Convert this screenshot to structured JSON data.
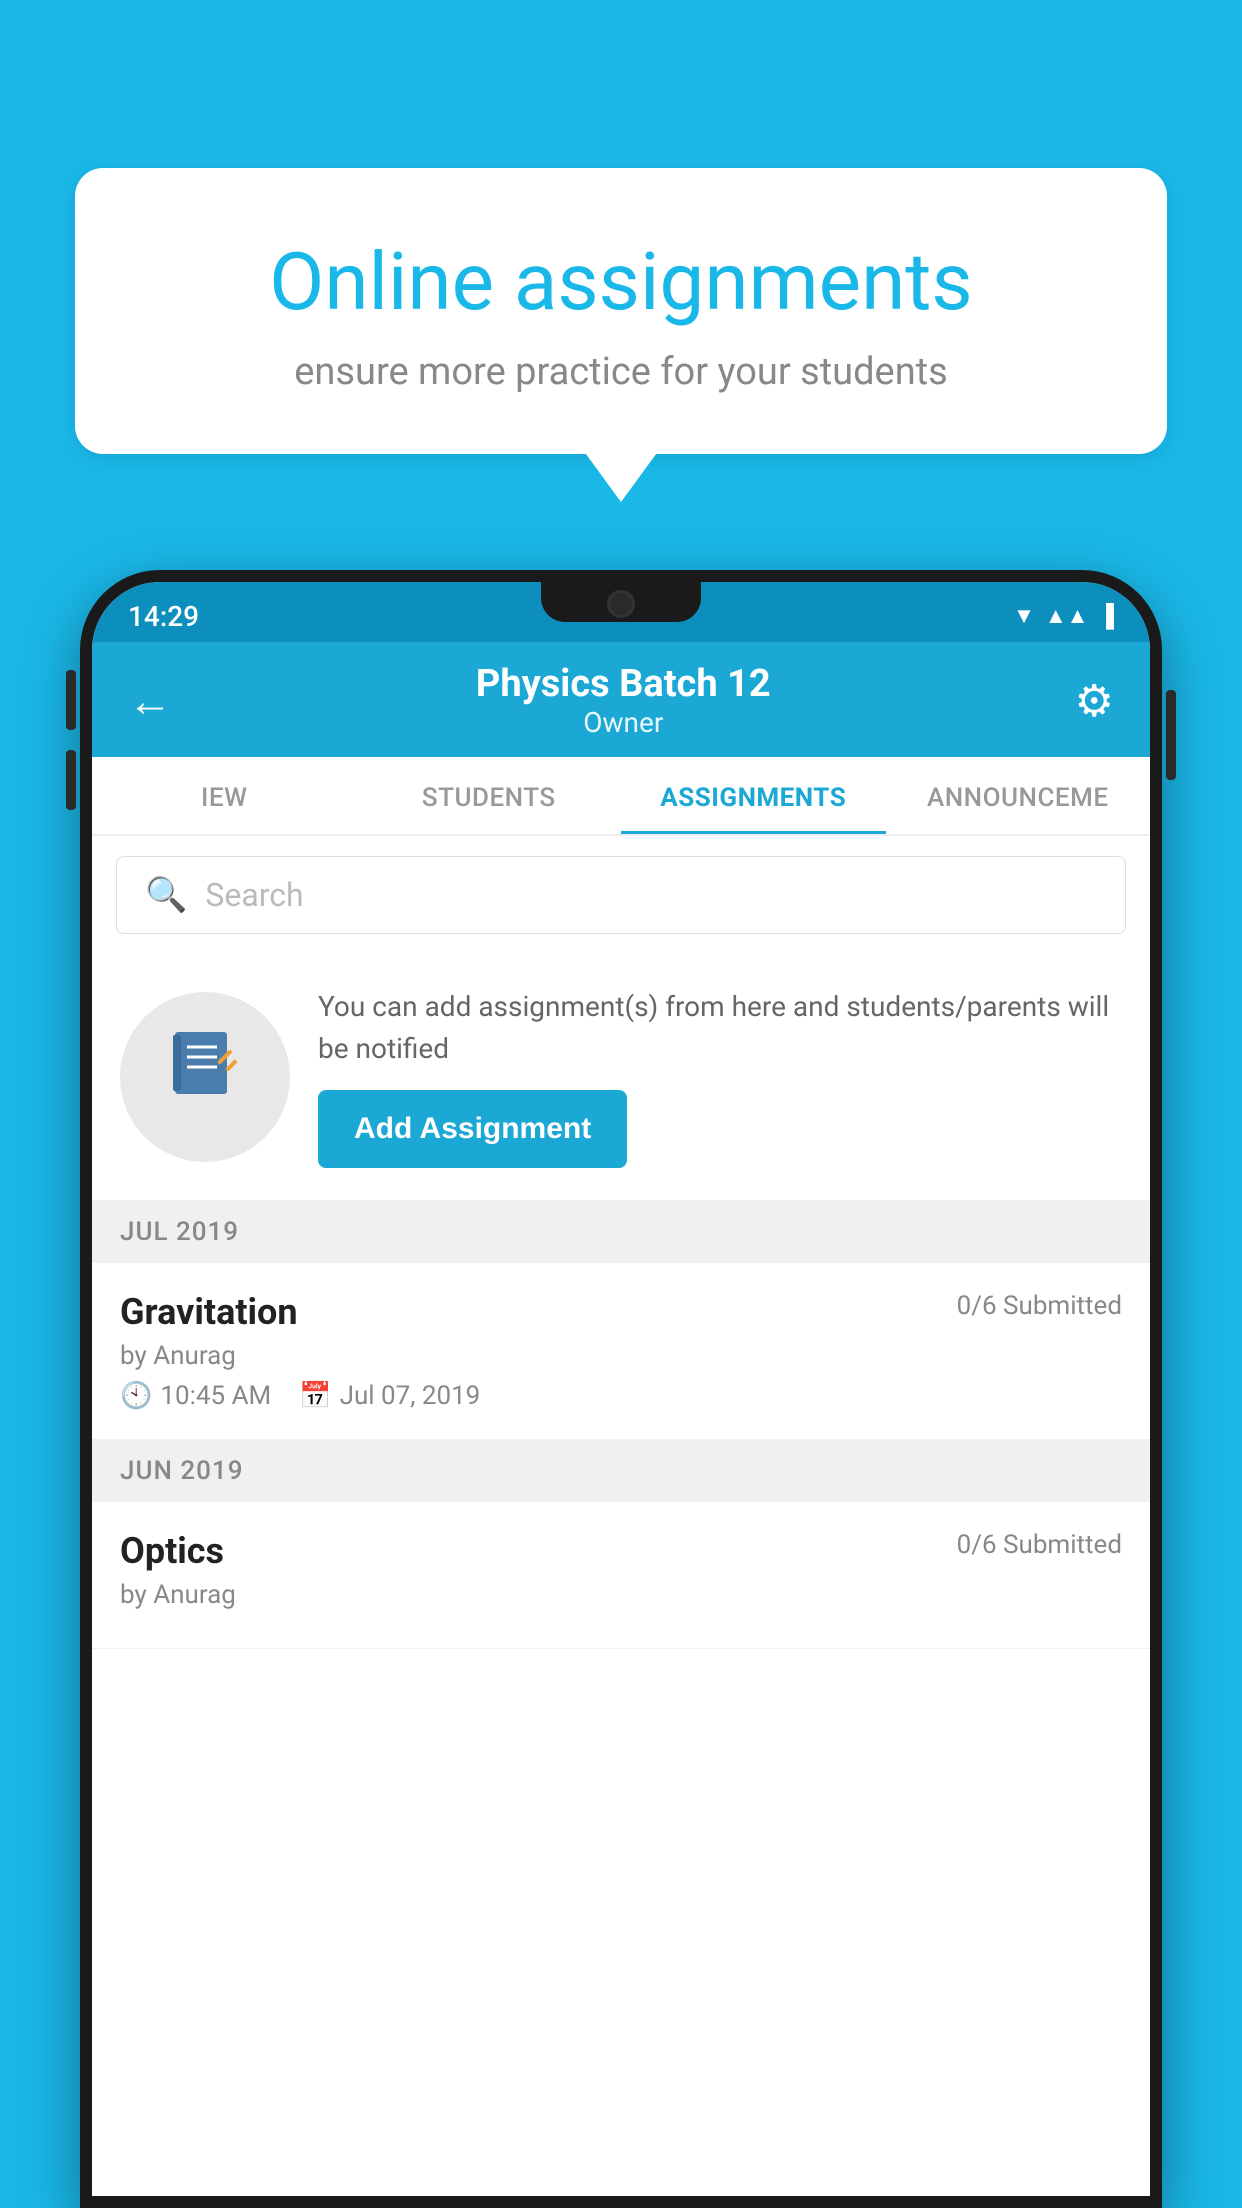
{
  "background_color": "#1ab8e8",
  "speech_bubble": {
    "title": "Online assignments",
    "subtitle": "ensure more practice for your students"
  },
  "status_bar": {
    "time": "14:29",
    "icons": [
      "▼",
      "◂▸",
      "▐"
    ]
  },
  "header": {
    "title": "Physics Batch 12",
    "subtitle": "Owner",
    "back_label": "←",
    "gear_label": "⚙"
  },
  "tabs": [
    {
      "label": "IEW",
      "active": false
    },
    {
      "label": "STUDENTS",
      "active": false
    },
    {
      "label": "ASSIGNMENTS",
      "active": true
    },
    {
      "label": "ANNOUNCEME",
      "active": false
    }
  ],
  "search": {
    "placeholder": "Search"
  },
  "promo": {
    "text": "You can add assignment(s) from here and students/parents will be notified",
    "button_label": "Add Assignment"
  },
  "sections": [
    {
      "header": "JUL 2019",
      "assignments": [
        {
          "name": "Gravitation",
          "submitted": "0/6 Submitted",
          "by": "by Anurag",
          "time": "10:45 AM",
          "date": "Jul 07, 2019"
        }
      ]
    },
    {
      "header": "JUN 2019",
      "assignments": [
        {
          "name": "Optics",
          "submitted": "0/6 Submitted",
          "by": "by Anurag",
          "time": "",
          "date": ""
        }
      ]
    }
  ]
}
